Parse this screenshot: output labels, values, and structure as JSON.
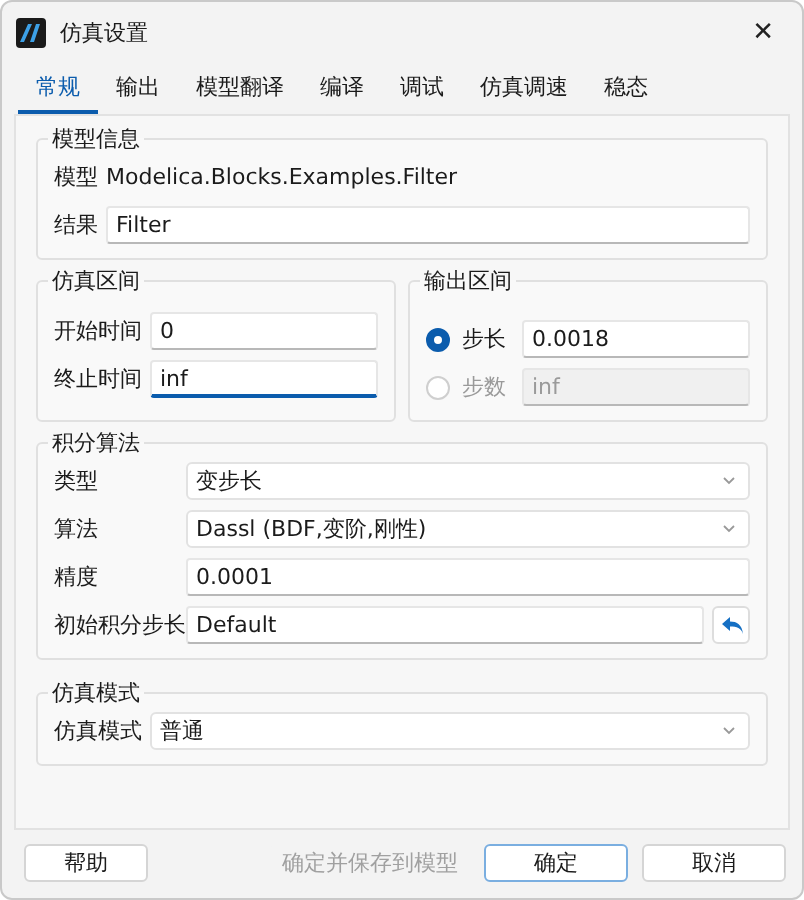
{
  "window": {
    "title": "仿真设置",
    "close": "✕"
  },
  "tabs": [
    {
      "label": "常规",
      "selected": true
    },
    {
      "label": "输出",
      "selected": false
    },
    {
      "label": "模型翻译",
      "selected": false
    },
    {
      "label": "编译",
      "selected": false
    },
    {
      "label": "调试",
      "selected": false
    },
    {
      "label": "仿真调速",
      "selected": false
    },
    {
      "label": "稳态",
      "selected": false
    }
  ],
  "model_info": {
    "title": "模型信息",
    "model_label": "模型",
    "model_value": "Modelica.Blocks.Examples.Filter",
    "result_label": "结果",
    "result_value": "Filter"
  },
  "sim_interval": {
    "title": "仿真区间",
    "fields": [
      {
        "label": "开始时间",
        "value": "0",
        "focused": false
      },
      {
        "label": "终止时间",
        "value": "inf",
        "focused": true
      }
    ]
  },
  "output_interval": {
    "title": "输出区间",
    "options": [
      {
        "label": "步长",
        "value": "0.0018",
        "selected": true,
        "disabled": false
      },
      {
        "label": "步数",
        "value": "inf",
        "selected": false,
        "disabled": true
      }
    ]
  },
  "integration": {
    "title": "积分算法",
    "rows": [
      {
        "kind": "select",
        "label": "类型",
        "value": "变步长"
      },
      {
        "kind": "select",
        "label": "算法",
        "value": "Dassl (BDF,变阶,刚性)"
      },
      {
        "kind": "input",
        "label": "精度",
        "value": "0.0001"
      },
      {
        "kind": "reset",
        "label": "初始积分步长",
        "value": "Default"
      }
    ]
  },
  "sim_mode": {
    "title": "仿真模式",
    "rows": [
      {
        "kind": "select",
        "label": "仿真模式",
        "value": "普通"
      }
    ]
  },
  "buttons": [
    {
      "label": "帮助",
      "disabled": false,
      "primary": false
    },
    {
      "label": "确定并保存到模型",
      "disabled": true,
      "primary": false
    },
    {
      "label": "确定",
      "disabled": false,
      "primary": true
    },
    {
      "label": "取消",
      "disabled": false,
      "primary": false
    }
  ]
}
